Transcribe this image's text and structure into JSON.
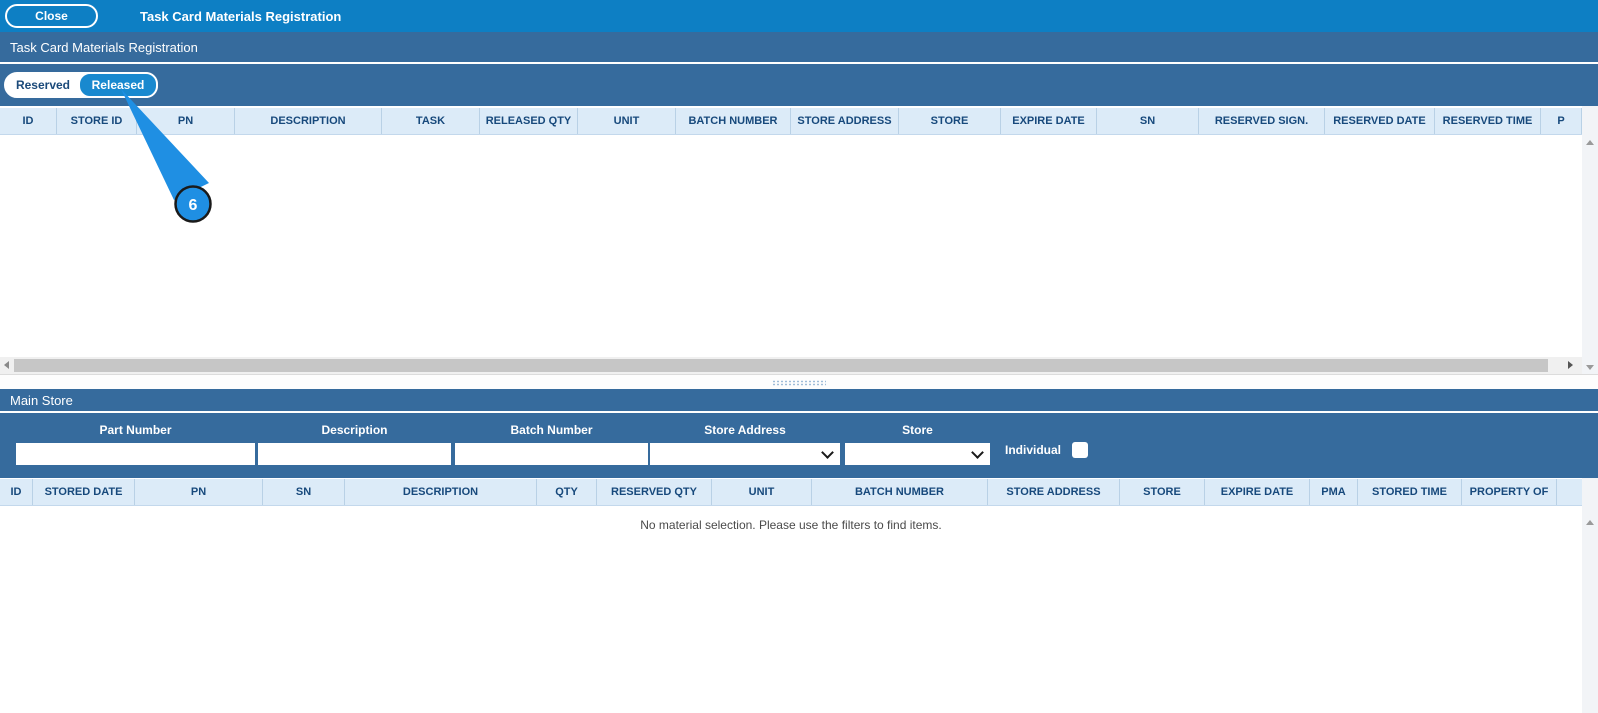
{
  "topbar": {
    "close_label": "Close",
    "title": "Task Card Materials Registration"
  },
  "section_header": {
    "title": "Task Card Materials Registration"
  },
  "tabs": {
    "reserved": {
      "label": "Reserved",
      "active": false
    },
    "released": {
      "label": "Released",
      "active": true
    }
  },
  "annotation": {
    "step_number": "6"
  },
  "released_table": {
    "columns": [
      "ID",
      "STORE ID",
      "PN",
      "DESCRIPTION",
      "TASK",
      "RELEASED QTY",
      "UNIT",
      "BATCH NUMBER",
      "STORE ADDRESS",
      "STORE",
      "EXPIRE DATE",
      "SN",
      "RESERVED SIGN.",
      "RESERVED DATE",
      "RESERVED TIME",
      "P"
    ],
    "rows": []
  },
  "main_store": {
    "title": "Main Store",
    "filters": {
      "part_number": {
        "label": "Part Number",
        "value": "",
        "placeholder": ""
      },
      "description": {
        "label": "Description",
        "value": "",
        "placeholder": ""
      },
      "batch_number": {
        "label": "Batch Number",
        "value": "",
        "placeholder": ""
      },
      "store_address": {
        "label": "Store Address",
        "selected": ""
      },
      "store": {
        "label": "Store",
        "selected": ""
      },
      "individual": {
        "label": "Individual",
        "checked": false
      }
    },
    "store_table": {
      "columns": [
        "ID",
        "STORED DATE",
        "PN",
        "SN",
        "DESCRIPTION",
        "QTY",
        "RESERVED QTY",
        "UNIT",
        "BATCH NUMBER",
        "STORE ADDRESS",
        "STORE",
        "EXPIRE DATE",
        "PMA",
        "STORED TIME",
        "PROPERTY OF"
      ],
      "rows": [],
      "empty_message": "No material selection. Please use the filters to find items."
    }
  },
  "colors": {
    "topbar": "#0d7fc4",
    "section_bar": "#366b9d",
    "tab_active": "#1989cf",
    "header_bg": "#dcebf8",
    "header_text": "#17497c",
    "annotation_blue": "#1f8fe3"
  }
}
